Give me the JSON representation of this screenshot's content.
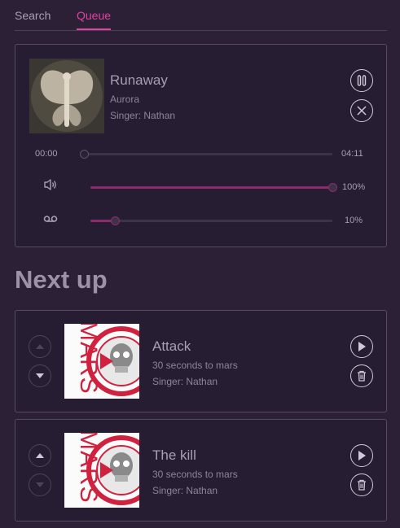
{
  "tabs": [
    {
      "label": "Search",
      "active": false
    },
    {
      "label": "Queue",
      "active": true
    }
  ],
  "now_playing": {
    "title": "Runaway",
    "artist": "Aurora",
    "singer": "Singer: Nathan",
    "time_current": "00:00",
    "time_total": "04:11",
    "progress": 0,
    "volume_label": "100%",
    "volume": 1.0,
    "vocals_label": "10%",
    "vocals": 0.1,
    "art_icon": "butterfly-wings-album-art"
  },
  "next_up": {
    "heading": "Next up",
    "items": [
      {
        "title": "Attack",
        "artist": "30 seconds to mars",
        "singer": "Singer: Nathan",
        "art_text": "MARS"
      },
      {
        "title": "The kill",
        "artist": "30 seconds to mars",
        "singer": "Singer: Nathan",
        "art_text": "MARS"
      }
    ]
  },
  "colors": {
    "background": "#2b2036",
    "accent": "#e042a4",
    "slider_fill": "#8a2c6c",
    "album_red": "#d0213e"
  }
}
